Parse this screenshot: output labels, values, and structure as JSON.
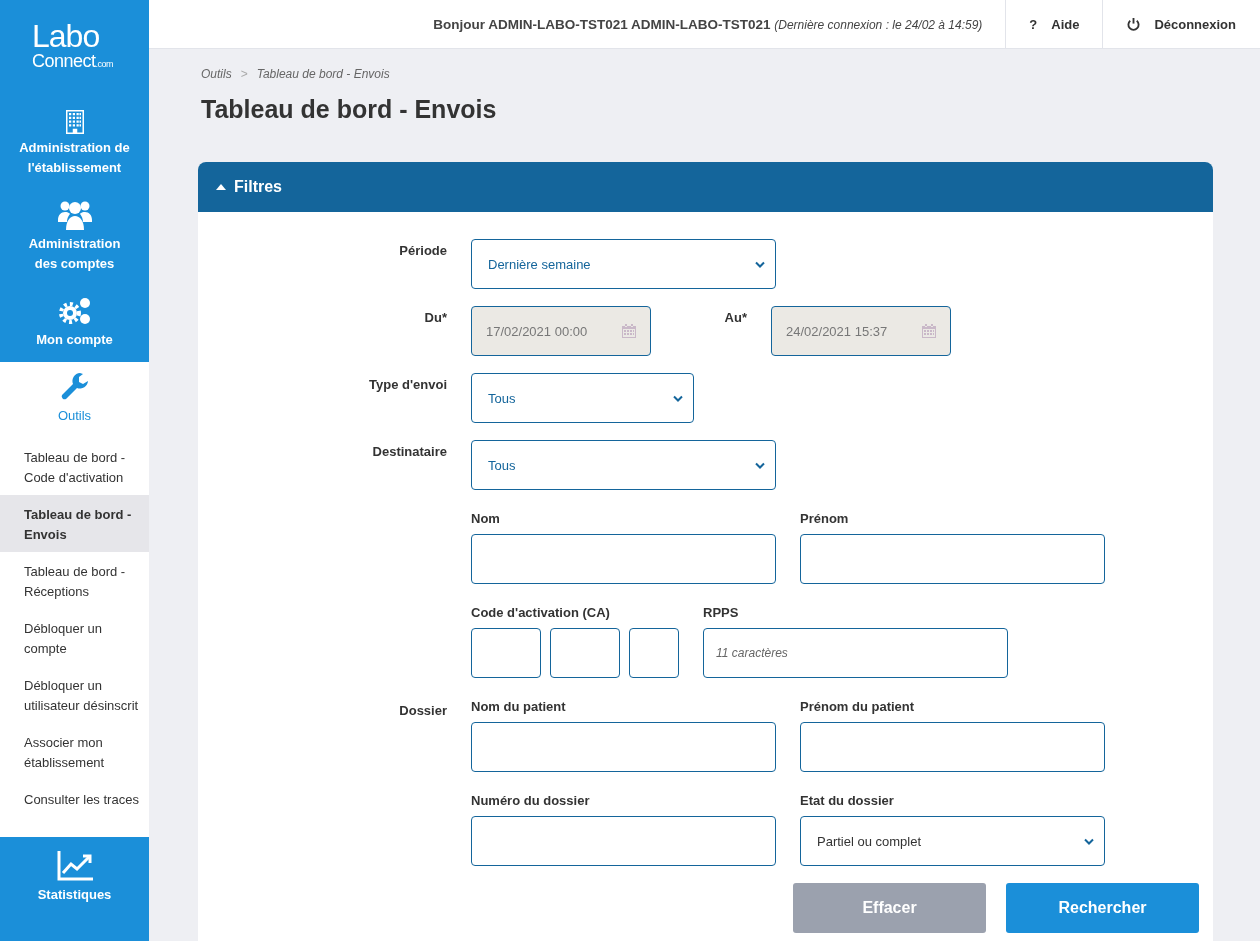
{
  "logo": {
    "line1": "Labo",
    "line2": "Connect",
    "suffix": ".com"
  },
  "nav_items": [
    {
      "label": "Administration de l'établissement",
      "kind": "building",
      "selected": false
    },
    {
      "label": "Administration des comptes",
      "kind": "users",
      "selected": false
    },
    {
      "label": "Mon compte",
      "kind": "gears",
      "selected": false
    },
    {
      "label": "Outils",
      "kind": "wrench",
      "selected": true,
      "submenu": [
        {
          "label": "Tableau de bord - Code d'activation",
          "selected": false
        },
        {
          "label": "Tableau de bord - Envois",
          "selected": true
        },
        {
          "label": "Tableau de bord - Réceptions",
          "selected": false
        },
        {
          "label": "Débloquer un compte",
          "selected": false
        },
        {
          "label": "Débloquer un utilisateur désinscrit",
          "selected": false
        },
        {
          "label": "Associer mon établissement",
          "selected": false
        },
        {
          "label": "Consulter les traces",
          "selected": false
        }
      ]
    },
    {
      "label": "Statistiques",
      "kind": "chart",
      "selected": false
    }
  ],
  "header": {
    "greeting": "Bonjour ADMIN-LABO-TST021 ADMIN-LABO-TST021",
    "last_login": "(Dernière connexion : le 24/02 à 14:59)",
    "help": {
      "icon": "?",
      "label": "Aide"
    },
    "logout": "Déconnexion"
  },
  "breadcrumb": [
    "Outils",
    "Tableau de bord - Envois"
  ],
  "breadcrumb_separator": ">",
  "page_title": "Tableau de bord - Envois",
  "filters": {
    "title": "Filtres",
    "expanded": true,
    "period": {
      "label": "Période",
      "value": "Dernière semaine"
    },
    "from": {
      "label": "Du*",
      "value": "17/02/2021 00:00",
      "disabled": true
    },
    "to": {
      "label": "Au*",
      "value": "24/02/2021 15:37",
      "disabled": true
    },
    "send_type": {
      "label": "Type d'envoi",
      "value": "Tous"
    },
    "recipient": {
      "label": "Destinataire",
      "value": "Tous"
    },
    "last_name": {
      "label": "Nom"
    },
    "first_name": {
      "label": "Prénom"
    },
    "activation_code": {
      "label": "Code d'activation (CA)"
    },
    "rpps": {
      "label": "RPPS",
      "placeholder": "11 caractères"
    },
    "dossier_label": "Dossier",
    "patient_last_name": {
      "label": "Nom du patient"
    },
    "patient_first_name": {
      "label": "Prénom du patient"
    },
    "dossier_number": {
      "label": "Numéro du dossier"
    },
    "dossier_state": {
      "label": "Etat du dossier",
      "value": "Partiel ou complet"
    },
    "buttons": {
      "clear": "Effacer",
      "search": "Rechercher"
    }
  }
}
